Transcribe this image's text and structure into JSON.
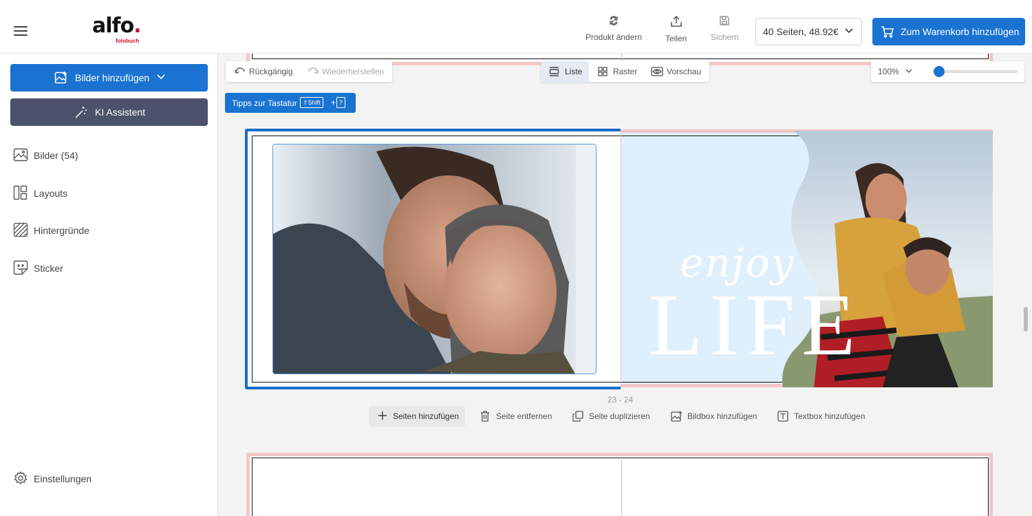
{
  "brand": {
    "logo_main": "alfo",
    "logo_dot": ".",
    "logo_sub": "fotobuch"
  },
  "header": {
    "produkt_aendern": "Produkt ändern",
    "teilen": "Teilen",
    "sichern": "Sichern",
    "pages_select": "40 Seiten, 48.92€",
    "cart_button": "Zum Warenkorb hinzufügen"
  },
  "sidebar": {
    "add_images": "Bilder hinzufügen",
    "ki_assistant": "KI Assistent",
    "items": [
      {
        "label": "Bilder (54)",
        "icon": "image-icon"
      },
      {
        "label": "Layouts",
        "icon": "layout-icon"
      },
      {
        "label": "Hintergründe",
        "icon": "background-pattern-icon"
      },
      {
        "label": "Sticker",
        "icon": "sticker-icon"
      }
    ],
    "settings": "Einstellungen"
  },
  "toolbar": {
    "undo": "Rückgängig",
    "redo": "Wiederherstellen",
    "view_list": "Liste",
    "view_grid": "Raster",
    "view_preview": "Vorschau",
    "zoom": "100%",
    "zoom_level": 0.0
  },
  "tips": {
    "label": "Tipps zur Tastatur",
    "key_shift": "⇧Shift",
    "plus": "+",
    "key_q": "?"
  },
  "spread": {
    "text_enjoy": "enjoy",
    "text_life": "LIFE",
    "page_numbers": "23 - 24"
  },
  "page_actions": {
    "add_pages": "Seiten hinzufügen",
    "remove_page": "Seite entfernen",
    "duplicate_page": "Seite duplizieren",
    "add_imagebox": "Bildbox hinzufügen",
    "add_textbox": "Textbox hinzufügen"
  },
  "colors": {
    "primary": "#1a73d1",
    "ki": "#4b5269",
    "spread_bg": "#dff0fc",
    "bleed": "#f2c6c6"
  }
}
